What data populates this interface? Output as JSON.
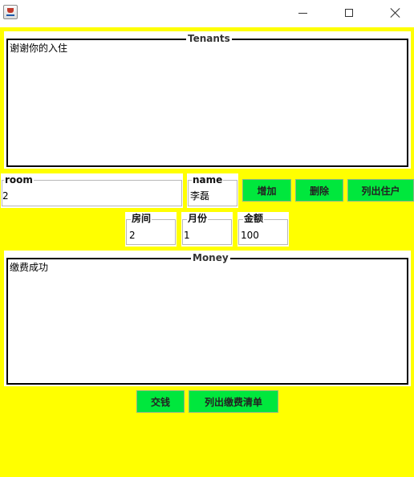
{
  "tenants": {
    "title": "Tenants",
    "text": "谢谢你的入住"
  },
  "fields": {
    "room": {
      "label": "room",
      "value": "2"
    },
    "name": {
      "label": "name",
      "value": "李磊"
    },
    "fang_jian": {
      "label": "房间",
      "value": "2"
    },
    "yue_fen": {
      "label": "月份",
      "value": "1"
    },
    "jin_e": {
      "label": "金额",
      "value": "100"
    }
  },
  "buttons": {
    "add": "增加",
    "delete": "删除",
    "list_tenants": "列出住户",
    "pay": "交钱",
    "list_payments": "列出缴费清单"
  },
  "money": {
    "title": "Money",
    "text": "缴费成功"
  },
  "colors": {
    "background": "#ffff00",
    "button": "#00e73d"
  },
  "icons": {
    "app": "java-icon",
    "minimize": "minimize-icon",
    "maximize": "maximize-icon",
    "close": "close-icon"
  }
}
